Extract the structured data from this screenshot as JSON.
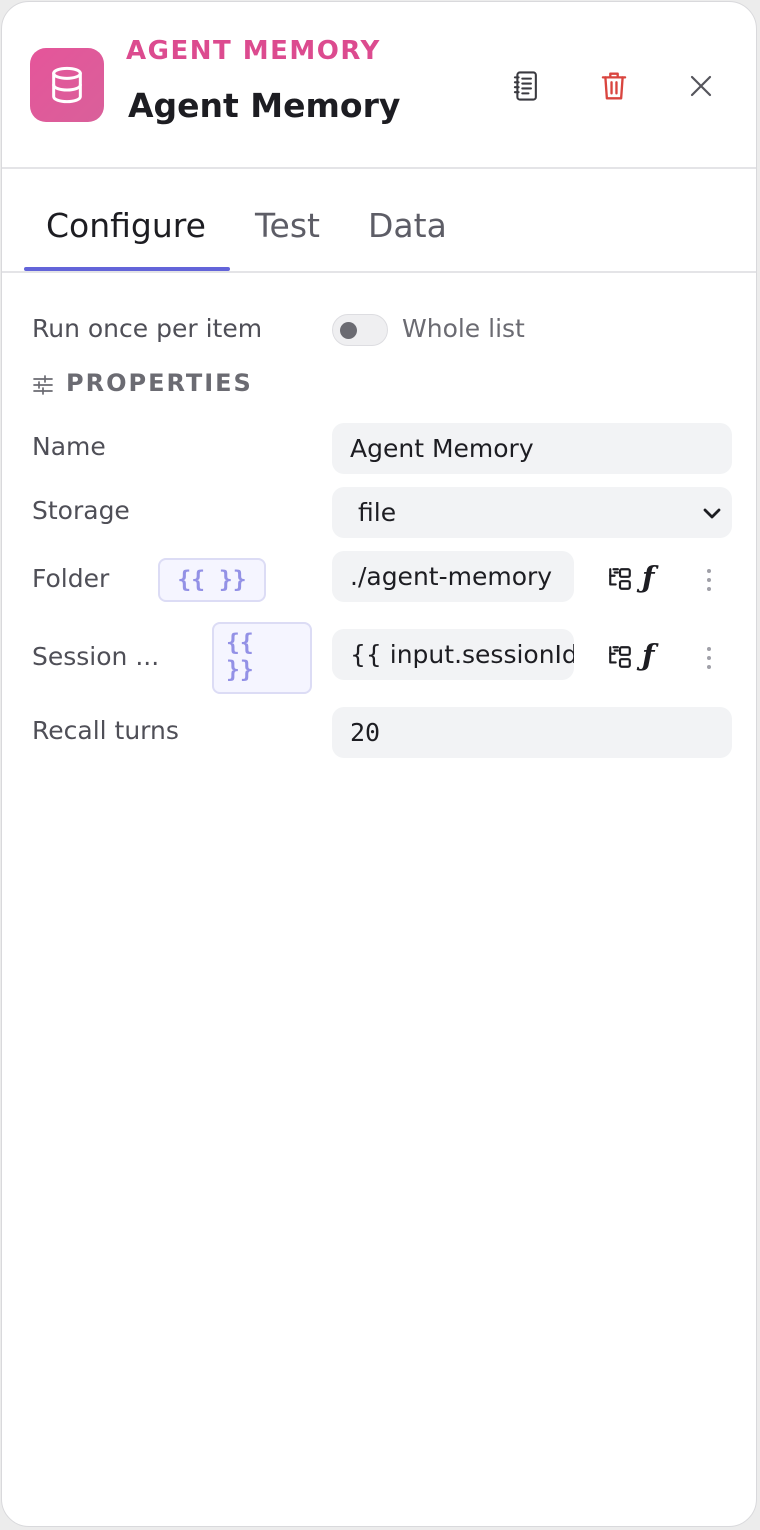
{
  "header": {
    "node_type": "AGENT MEMORY",
    "node_title": "Agent Memory",
    "icon": "database-icon",
    "accent_color": "#dc4b8f",
    "actions": [
      "docs-icon",
      "trash-icon",
      "close-icon"
    ]
  },
  "tabs": [
    {
      "label": "Configure",
      "active": true
    },
    {
      "label": "Test",
      "active": false
    },
    {
      "label": "Data",
      "active": false
    }
  ],
  "run_mode": {
    "label": "Run once per item",
    "toggle_label": "Whole list",
    "enabled": false
  },
  "properties": {
    "section_title": "PROPERTIES",
    "name": {
      "label": "Name",
      "value": "Agent Memory"
    },
    "storage": {
      "label": "Storage",
      "value": "file"
    },
    "folder": {
      "label": "Folder",
      "expr_chip": "{{ }}",
      "value": "./agent-memory"
    },
    "session": {
      "label": "Session ...",
      "expr_chip_line1": "{{",
      "expr_chip_line2": "}}",
      "value": "{{ input.sessionId"
    },
    "recall_turns": {
      "label": "Recall turns",
      "value": "20"
    }
  },
  "colors": {
    "tab_active_underline": "#6364d9",
    "delete_icon": "#d9453f",
    "expr_chip_text": "#9391e6"
  }
}
